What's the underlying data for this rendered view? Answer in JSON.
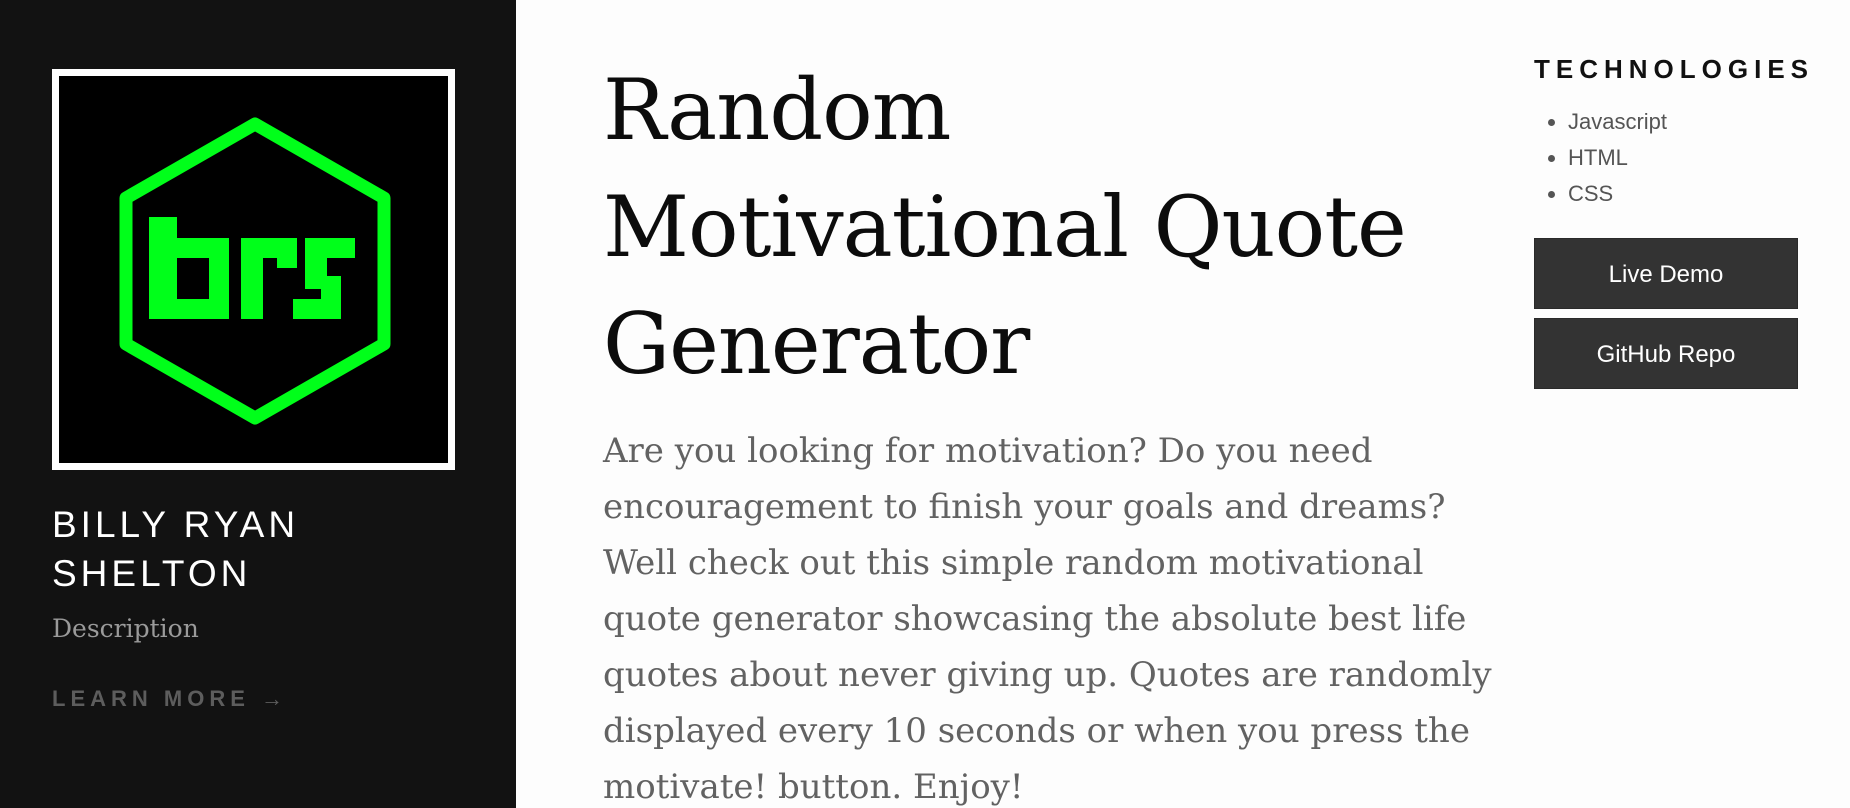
{
  "sidebar": {
    "logo": {
      "text": "brs",
      "accent_color": "#00ff1a",
      "frame_color": "#ffffff",
      "background": "#000000"
    },
    "author_name": "BILLY RYAN SHELTON",
    "description": "Description",
    "learn_more": "LEARN MORE →"
  },
  "main": {
    "title": "Random Motivational Quote Generator",
    "description": "Are you looking for motivation? Do you need encouragement to finish your goals and dreams? Well check out this simple random motivational quote generator showcasing the absolute best life quotes about never giving up. Quotes are randomly displayed every 10 seconds or when you press the motivate! button. Enjoy!"
  },
  "aside": {
    "technologies_heading": "TECHNOLOGIES",
    "technologies": [
      "Javascript",
      "HTML",
      "CSS"
    ],
    "live_demo_label": "Live Demo",
    "github_repo_label": "GitHub Repo"
  }
}
